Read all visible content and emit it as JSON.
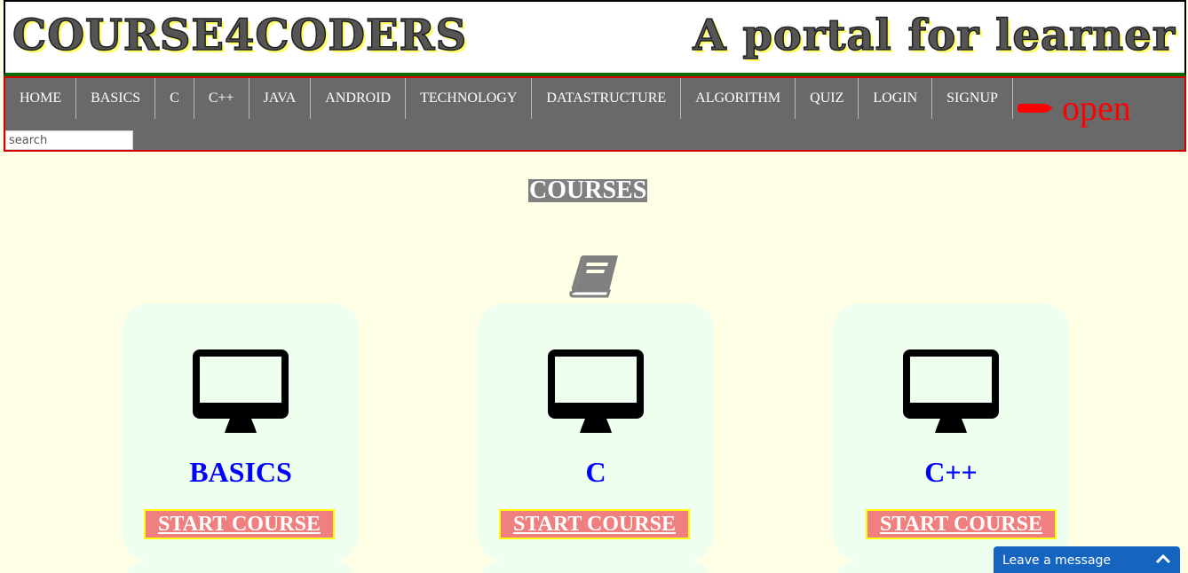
{
  "header": {
    "logo": "COURSE4CODERS",
    "tagline": "A portal for learner"
  },
  "nav": {
    "items": [
      "HOME",
      "BASICS",
      "C",
      "C++",
      "JAVA",
      "ANDROID",
      "TECHNOLOGY",
      "DATASTRUCTURE",
      "ALGORITHM",
      "QUIZ",
      "LOGIN",
      "SIGNUP"
    ],
    "open_label": "open",
    "search_placeholder": "search"
  },
  "main": {
    "section_title": "COURSES",
    "cards": [
      {
        "title": "BASICS",
        "button": "START COURSE"
      },
      {
        "title": "C",
        "button": "START COURSE"
      },
      {
        "title": "C++",
        "button": "START COURSE"
      }
    ]
  },
  "chat": {
    "label": "Leave a message"
  },
  "colors": {
    "nav_bg": "#696969",
    "accent_red": "#ff0000",
    "card_bg": "#eefff0",
    "title_blue": "#0000ff",
    "button_bg": "#f08080",
    "chat_bg": "#1565c0"
  }
}
